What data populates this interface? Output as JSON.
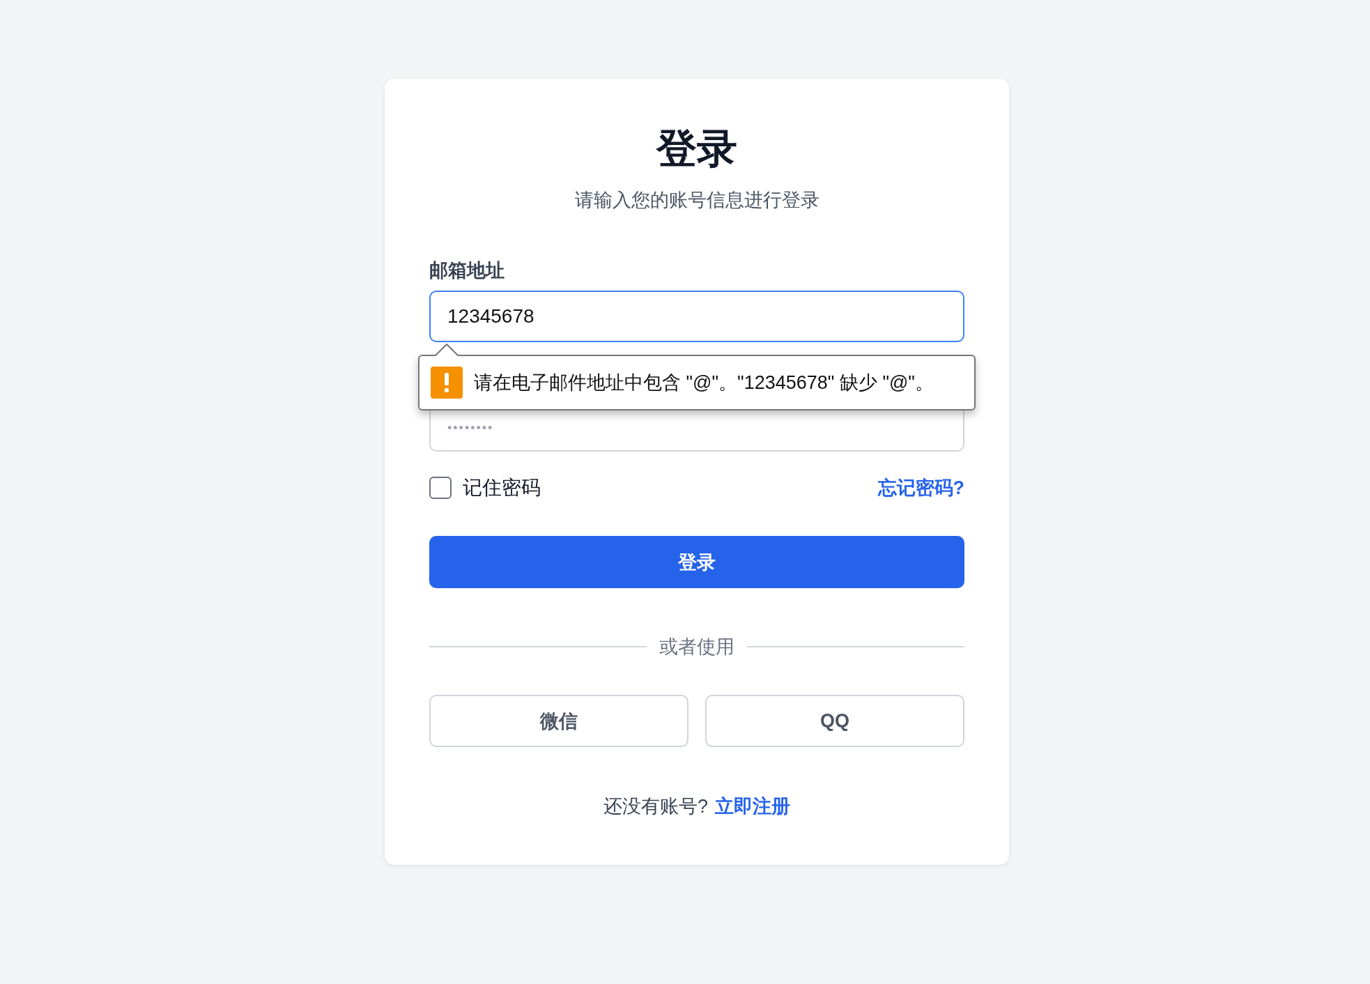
{
  "header": {
    "title": "登录",
    "subtitle": "请输入您的账号信息进行登录"
  },
  "email": {
    "label": "邮箱地址",
    "value": "12345678"
  },
  "validation": {
    "message": "请在电子邮件地址中包含 \"@\"。\"12345678\" 缺少 \"@\"。"
  },
  "password": {
    "placeholder": "••••••••"
  },
  "remember": {
    "label": "记住密码",
    "checked": false
  },
  "forgot_link": "忘记密码?",
  "submit": "登录",
  "divider": "或者使用",
  "social_buttons": [
    "微信",
    "QQ"
  ],
  "footer": {
    "text": "还没有账号?",
    "link": "立即注册"
  }
}
